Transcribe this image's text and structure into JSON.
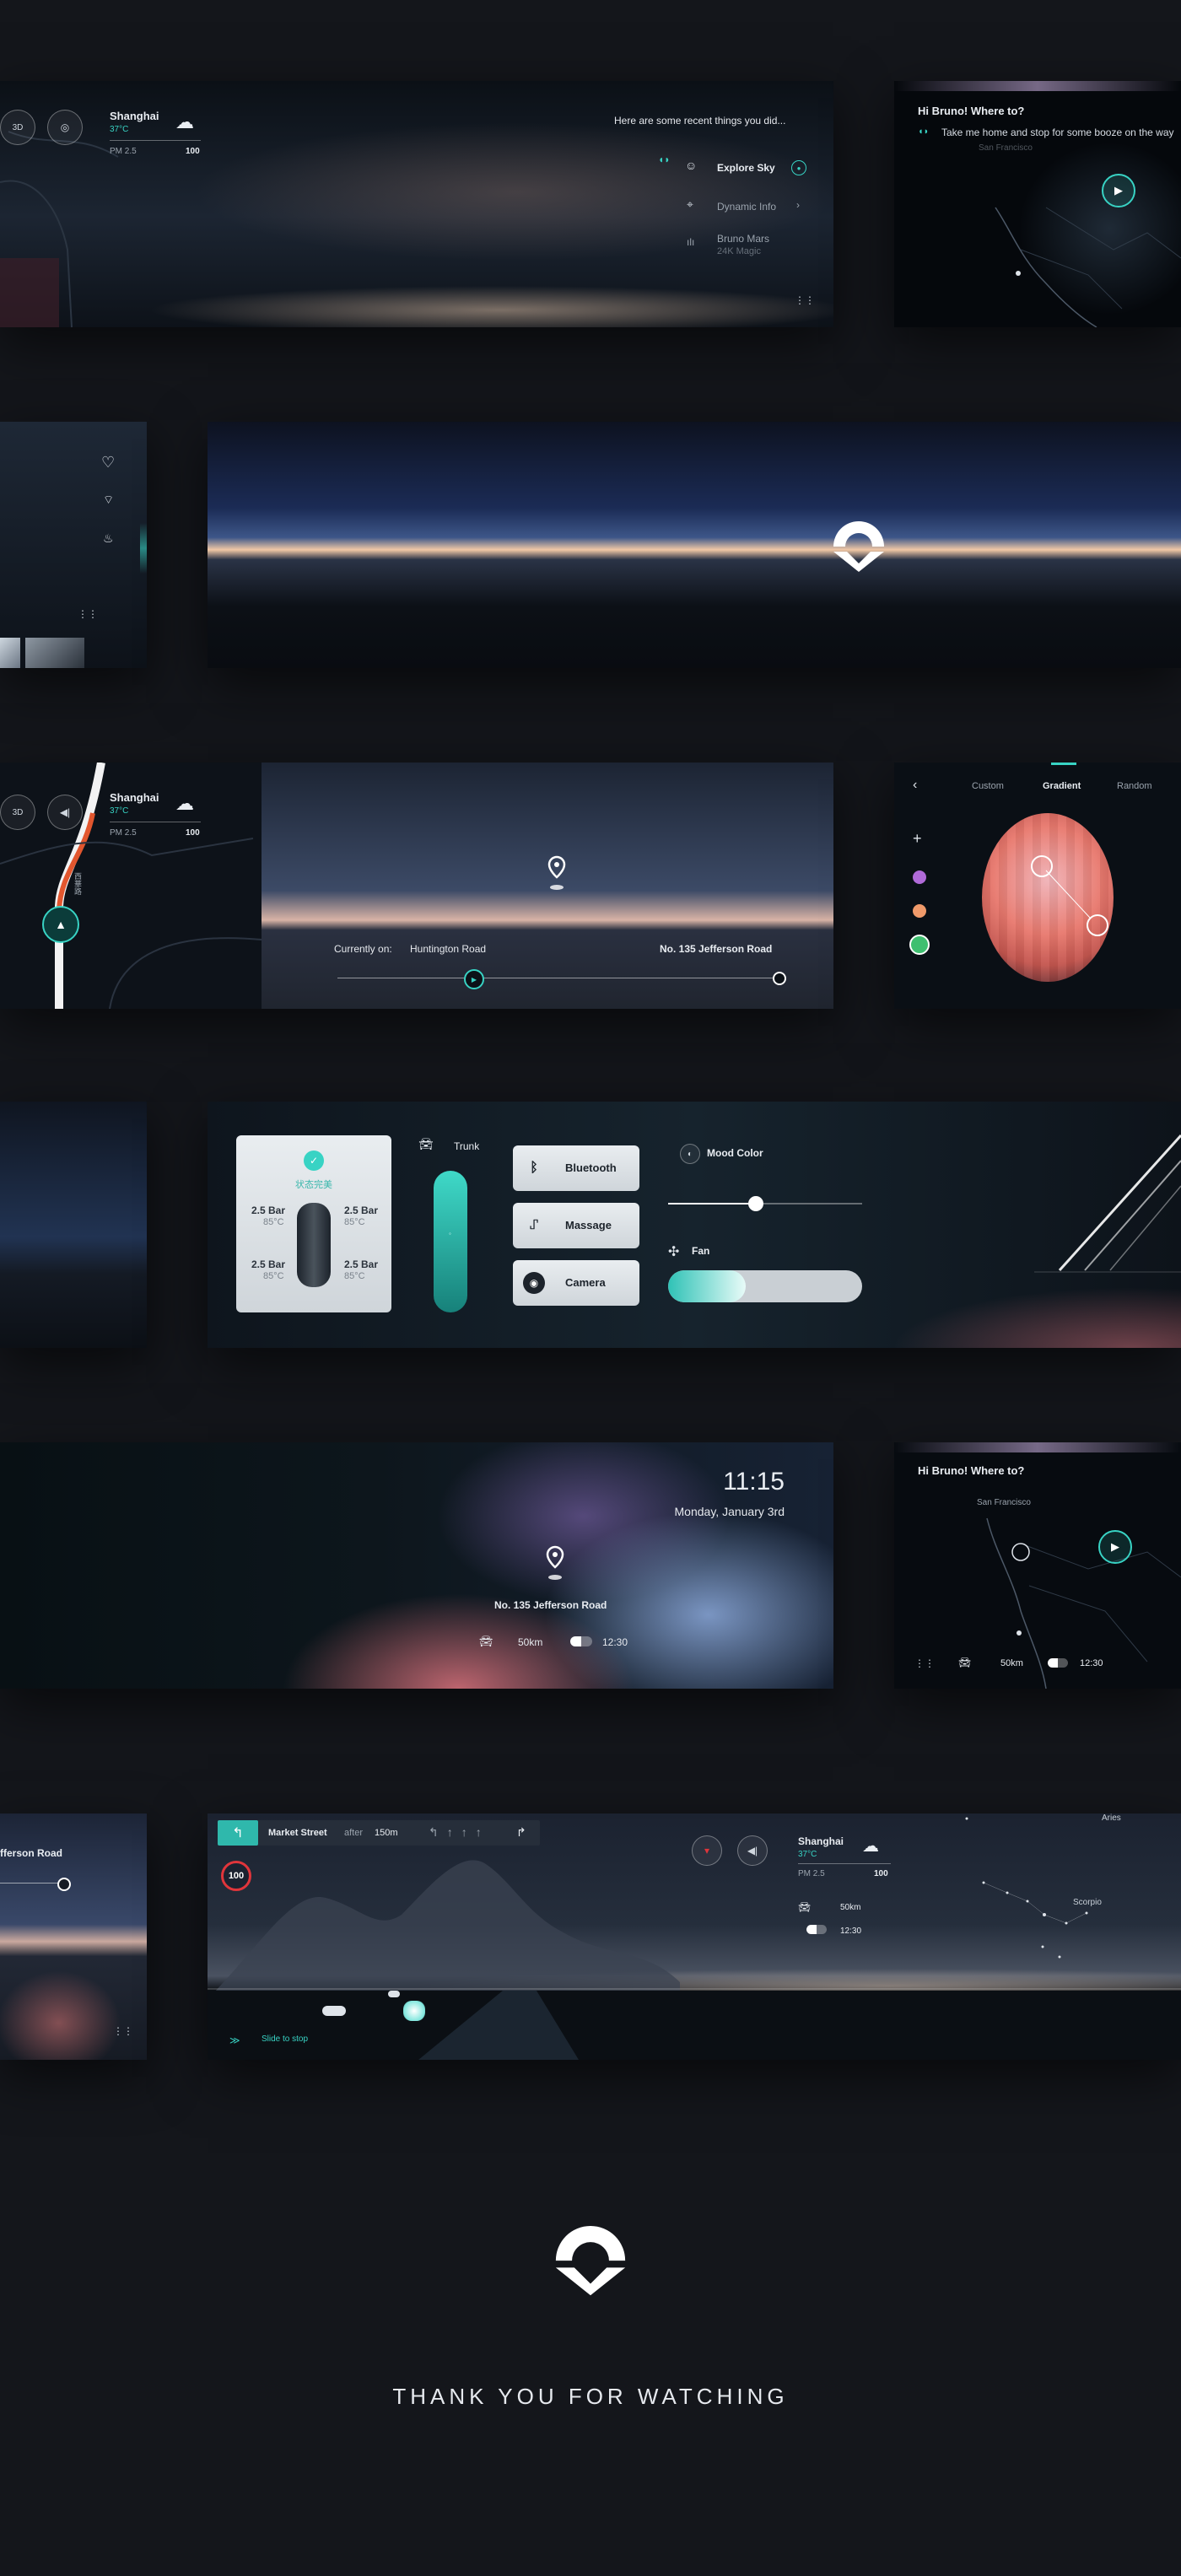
{
  "weather": {
    "city": "Shanghai",
    "temp": "37°C",
    "pm_label": "PM 2.5",
    "pm_value": "100"
  },
  "view_3d": "3D",
  "panel1": {
    "recent_title": "Here are some recent things you did...",
    "items": [
      {
        "label": "Explore Sky"
      },
      {
        "label": "Dynamic Info"
      },
      {
        "label": "Bruno Mars",
        "sub": "24K Magic"
      }
    ]
  },
  "voice": {
    "greeting": "Hi Bruno! Where to?",
    "query": "Take me home and stop for some booze on the way",
    "map_label": "San Francisco"
  },
  "nav_panel": {
    "current_prefix": "Currently on:",
    "current_road": "Huntington Road",
    "destination": "No. 135 Jefferson Road",
    "side_label": "西華路"
  },
  "color_picker": {
    "tabs": [
      "Custom",
      "Gradient",
      "Random"
    ],
    "active_tab": "Gradient",
    "add_symbol": "+"
  },
  "vehicle": {
    "status": "状态完美",
    "tires": [
      {
        "pressure": "2.5 Bar",
        "temp": "85°C"
      },
      {
        "pressure": "2.5 Bar",
        "temp": "85°C"
      },
      {
        "pressure": "2.5 Bar",
        "temp": "85°C"
      },
      {
        "pressure": "2.5 Bar",
        "temp": "85°C"
      }
    ],
    "trunk_label": "Trunk",
    "buttons": {
      "bluetooth": "Bluetooth",
      "massage": "Massage",
      "camera": "Camera"
    },
    "mood_color_label": "Mood Color",
    "mood_level": 0.45,
    "fan_label": "Fan",
    "fan_level": 0.4
  },
  "clock": {
    "time": "11:15",
    "date": "Monday,  January 3rd",
    "destination": "No. 135 Jefferson Road",
    "range": "50km",
    "eta": "12:30"
  },
  "voice2": {
    "greeting": "Hi Bruno! Where to?",
    "map_label": "San Francisco",
    "range": "50km",
    "eta": "12:30"
  },
  "partial_road": "fferson Road",
  "driving": {
    "street": "Market Street",
    "after": "after",
    "distance": "150m",
    "speed_limit": "100",
    "range": "50km",
    "eta": "12:30",
    "slide": "Slide to stop",
    "constellations": [
      "Aries",
      "Scorpio"
    ]
  },
  "footer": {
    "thanks": "THANK YOU FOR WATCHING"
  },
  "colors": {
    "accent": "#38d3c4",
    "bg": "#14161b",
    "warning": "#e0353b"
  }
}
